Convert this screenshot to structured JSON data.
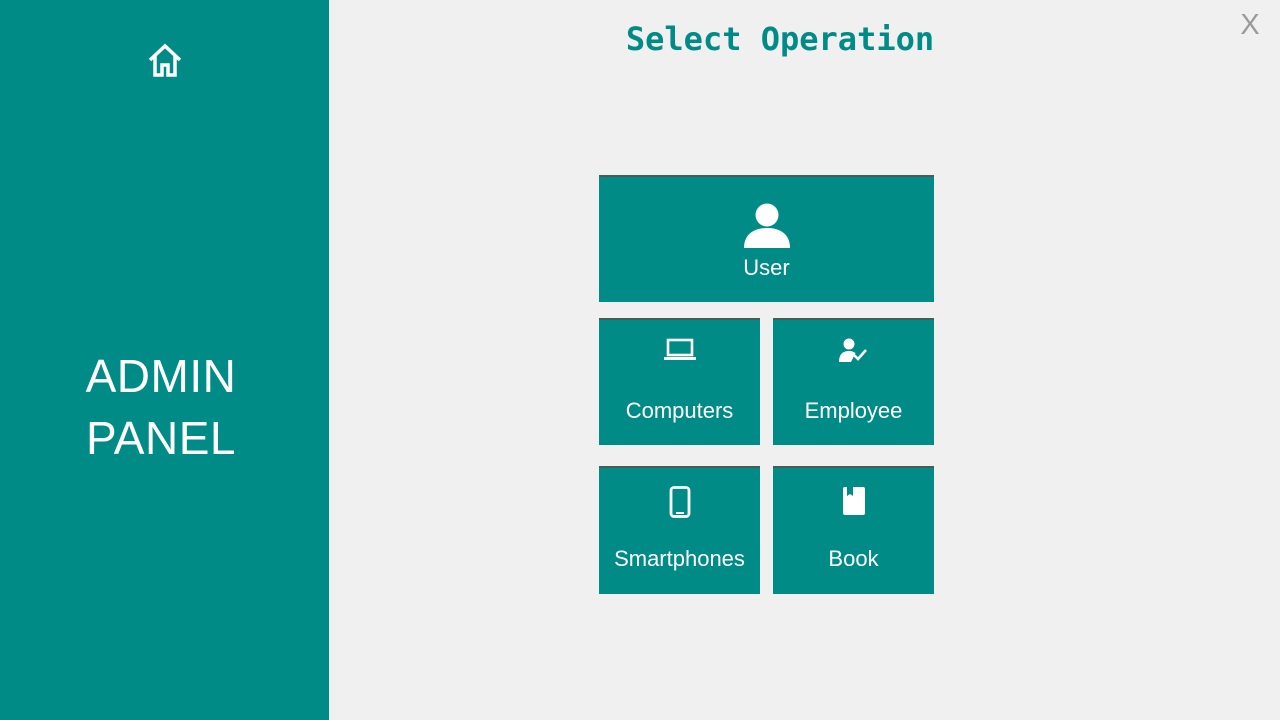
{
  "sidebar": {
    "home_icon": "home-icon",
    "title_line1": "ADMIN",
    "title_line2": "PANEL"
  },
  "header": {
    "title": "Select Operation",
    "close_label": "X"
  },
  "tiles": {
    "user": {
      "label": "User",
      "icon": "person-icon"
    },
    "computers": {
      "label": "Computers",
      "icon": "laptop-icon"
    },
    "employee": {
      "label": "Employee",
      "icon": "person-check-icon"
    },
    "smartphones": {
      "label": "Smartphones",
      "icon": "smartphone-icon"
    },
    "book": {
      "label": "Book",
      "icon": "book-icon"
    }
  },
  "colors": {
    "accent": "#008b87",
    "background": "#f0f0f0",
    "tile_text": "#ffffff",
    "close": "#9a9a9a"
  }
}
